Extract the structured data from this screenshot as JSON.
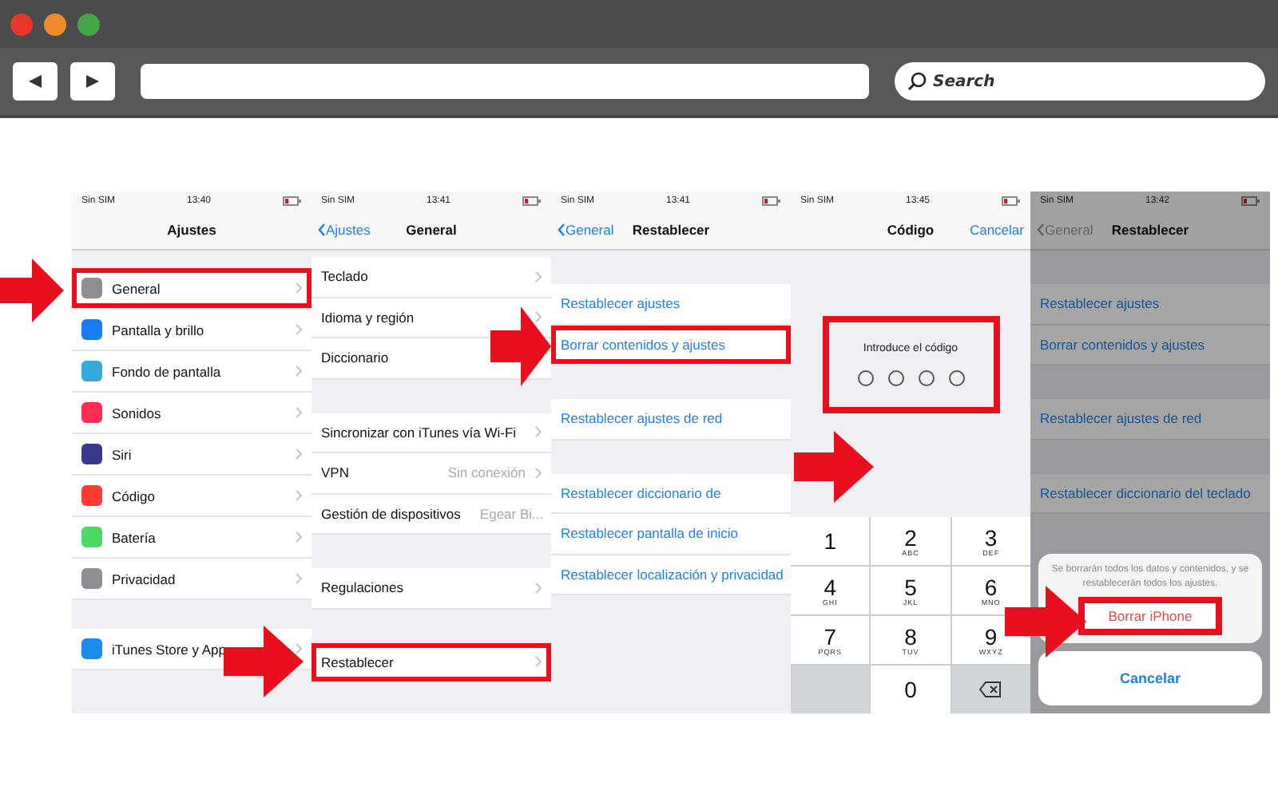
{
  "browser": {
    "search_placeholder": "Search"
  },
  "screens": [
    {
      "kind": "settings",
      "status": {
        "carrier": "Sin SIM",
        "time": "13:40"
      },
      "nav": {
        "title": "Ajustes"
      },
      "sections": [
        {
          "rows": [
            {
              "label": "General",
              "color": "#8e8e93",
              "highlighted": true
            },
            {
              "label": "Pantalla y brillo",
              "color": "#1a7cf5",
              "highlighted": false
            },
            {
              "label": "Fondo de pantalla",
              "color": "#34aadc",
              "highlighted": false
            },
            {
              "label": "Sonidos",
              "color": "#ff2d55",
              "highlighted": false
            },
            {
              "label": "Siri",
              "color": "#3a3a8c",
              "highlighted": false
            },
            {
              "label": "Código",
              "color": "#ff3b30",
              "highlighted": false
            },
            {
              "label": "Batería",
              "color": "#4cd964",
              "highlighted": false
            },
            {
              "label": "Privacidad",
              "color": "#8e8e93",
              "highlighted": false
            }
          ]
        },
        {
          "rows": [
            {
              "label": "iTunes Store y App",
              "color": "#1a8cf0",
              "highlighted": false
            }
          ]
        }
      ]
    },
    {
      "kind": "settings",
      "status": {
        "carrier": "Sin SIM",
        "time": "13:41"
      },
      "nav": {
        "back": "Ajustes",
        "title": "General"
      },
      "sections": [
        {
          "rows": [
            {
              "label": "Teclado",
              "highlighted": false
            },
            {
              "label": "Idioma y región",
              "highlighted": false
            },
            {
              "label": "Diccionario",
              "highlighted": false
            }
          ]
        },
        {
          "rows": [
            {
              "label": "Sincronizar con iTunes vía Wi-Fi",
              "highlighted": false
            },
            {
              "label": "VPN",
              "value": "Sin conexión",
              "highlighted": false
            },
            {
              "label": "Gestión de dispositivos",
              "value": "Egear Bi...",
              "highlighted": false
            }
          ]
        },
        {
          "rows": [
            {
              "label": "Regulaciones",
              "highlighted": false
            }
          ]
        },
        {
          "rows": [
            {
              "label": "Restablecer",
              "highlighted": true
            }
          ]
        }
      ]
    },
    {
      "kind": "links",
      "status": {
        "carrier": "Sin SIM",
        "time": "13:41"
      },
      "nav": {
        "back": "General",
        "title": "Restablecer"
      },
      "sections": [
        {
          "rows": [
            {
              "label": "Restablecer ajustes",
              "highlighted": false
            },
            {
              "label": "Borrar contenidos y ajustes",
              "highlighted": true
            }
          ]
        },
        {
          "rows": [
            {
              "label": "Restablecer ajustes de red",
              "highlighted": false
            }
          ]
        },
        {
          "rows": [
            {
              "label": "Restablecer diccionario de",
              "highlighted": false
            },
            {
              "label": "Restablecer pantalla de inicio",
              "highlighted": false
            },
            {
              "label": "Restablecer localización y privacidad",
              "highlighted": false
            }
          ]
        }
      ]
    },
    {
      "kind": "passcode",
      "status": {
        "carrier": "Sin SIM",
        "time": "13:45"
      },
      "nav": {
        "title": "Código",
        "action": "Cancelar"
      },
      "prompt": "Introduce el código",
      "highlighted": true,
      "keys": [
        {
          "kind": "digit",
          "digit": "1"
        },
        {
          "kind": "digit",
          "digit": "2",
          "letters": "ABC"
        },
        {
          "kind": "digit",
          "digit": "3",
          "letters": "DEF"
        },
        {
          "kind": "digit",
          "digit": "4",
          "letters": "GHI"
        },
        {
          "kind": "digit",
          "digit": "5",
          "letters": "JKL"
        },
        {
          "kind": "digit",
          "digit": "6",
          "letters": "MNO"
        },
        {
          "kind": "digit",
          "digit": "7",
          "letters": "PQRS"
        },
        {
          "kind": "digit",
          "digit": "8",
          "letters": "TUV"
        },
        {
          "kind": "digit",
          "digit": "9",
          "letters": "WXYZ"
        },
        {
          "kind": "blank"
        },
        {
          "kind": "digit",
          "digit": "0"
        },
        {
          "kind": "delete"
        }
      ]
    },
    {
      "kind": "confirm",
      "status": {
        "carrier": "Sin SIM",
        "time": "13:42"
      },
      "nav": {
        "back": "General",
        "title": "Restablecer"
      },
      "sections": [
        {
          "rows": [
            {
              "label": "Restablecer ajustes",
              "highlighted": false
            },
            {
              "label": "Borrar contenidos y ajustes",
              "highlighted": false
            }
          ]
        },
        {
          "rows": [
            {
              "label": "Restablecer ajustes de red",
              "highlighted": false
            }
          ]
        },
        {
          "rows": [
            {
              "label": "Restablecer diccionario del teclado",
              "highlighted": false
            }
          ]
        }
      ],
      "sheet": {
        "message": "Se borrarán todos los datos y contenidos, y se restablecerán todos los ajustes.",
        "confirm": "Borrar iPhone",
        "confirm_highlighted": true,
        "cancel": "Cancelar"
      }
    }
  ]
}
